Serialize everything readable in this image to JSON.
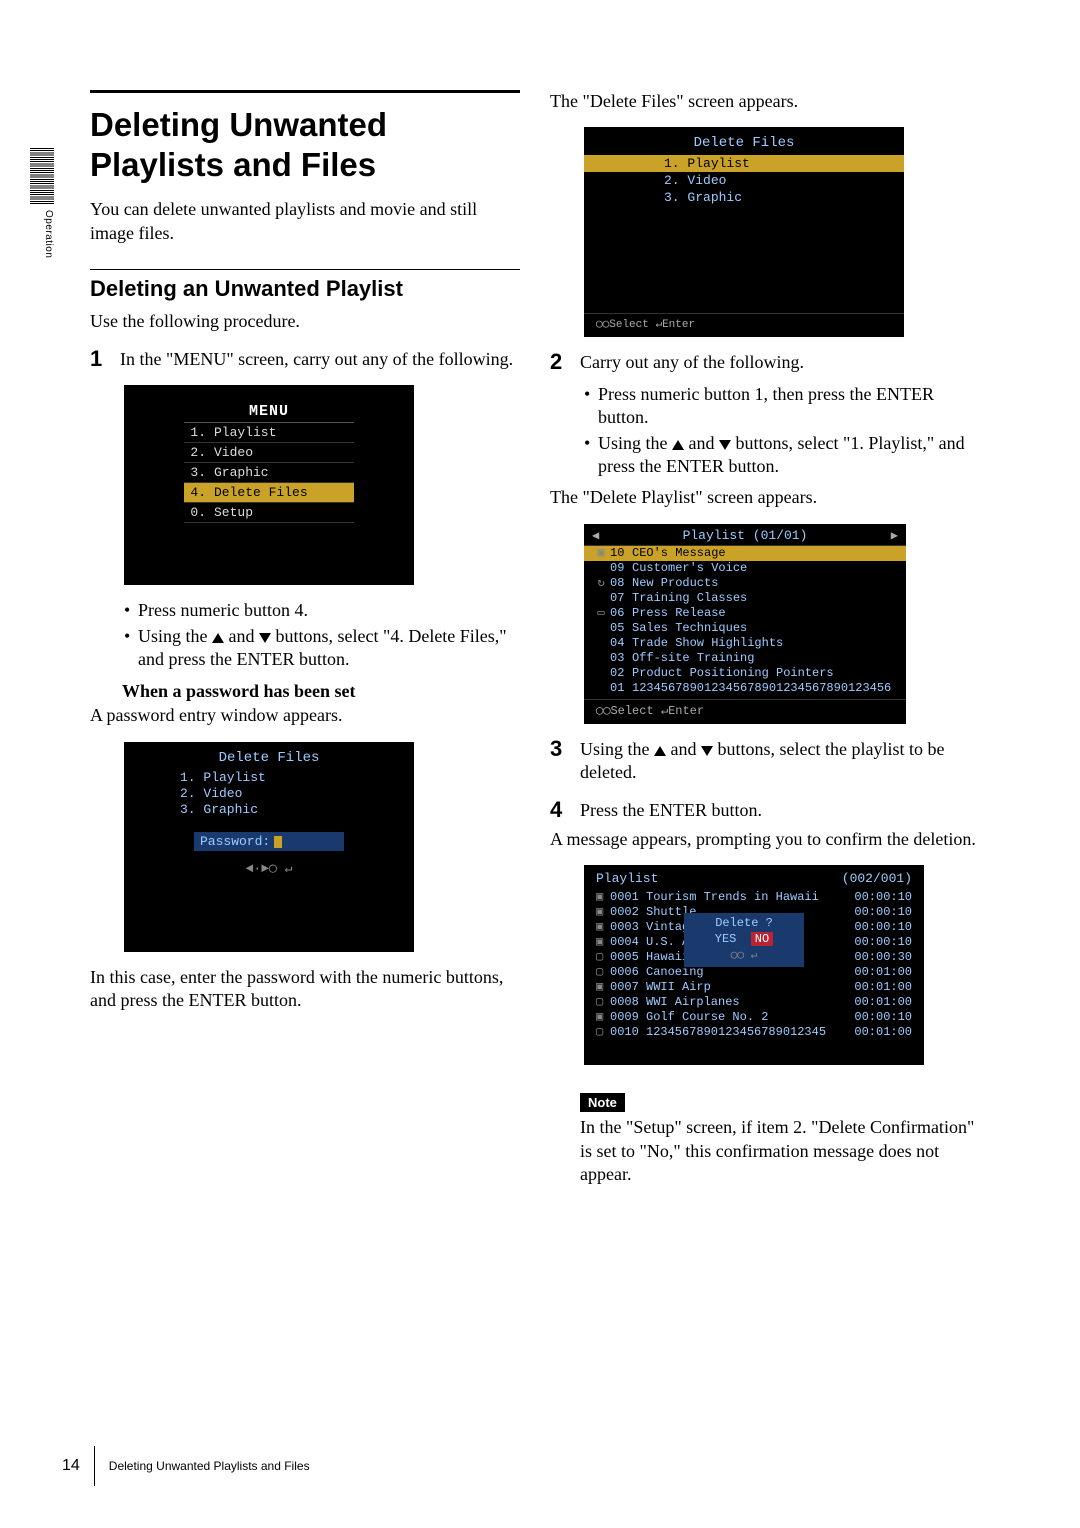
{
  "side_tab": "Operation",
  "heading": "Deleting Unwanted Playlists and Files",
  "intro": "You can delete unwanted playlists and movie and still image files.",
  "subheading": "Deleting an Unwanted Playlist",
  "sub_intro": "Use the following procedure.",
  "step1": {
    "num": "1",
    "text": "In the \"MENU\" screen, carry out any of the following.",
    "menu": {
      "title": "MENU",
      "items": [
        {
          "n": "1.",
          "label": "Playlist"
        },
        {
          "n": "2.",
          "label": "Video"
        },
        {
          "n": "3.",
          "label": "Graphic"
        },
        {
          "n": "4.",
          "label": "Delete Files",
          "selected": true
        },
        {
          "n": "0.",
          "label": "Setup"
        }
      ]
    },
    "bullets": [
      "Press numeric button 4.",
      "Using the ▲ and ▼ buttons, select \"4. Delete Files,\" and press the ENTER button."
    ],
    "pw_head": "When a password has been set",
    "pw_text": "A password entry window appears.",
    "pw_osd": {
      "title": "Delete Files",
      "items": [
        "1. Playlist",
        "2. Video",
        "3. Graphic"
      ],
      "pass_label": "Password:",
      "icons": "◄·►◯   ↵"
    },
    "pw_after": "In this case, enter the password with the numeric buttons, and press the ENTER button."
  },
  "right_intro": "The \"Delete Files\" screen appears.",
  "delsel": {
    "title": "Delete Files",
    "items": [
      {
        "n": "1.",
        "label": "Playlist",
        "selected": true
      },
      {
        "n": "2.",
        "label": "Video"
      },
      {
        "n": "3.",
        "label": "Graphic"
      }
    ],
    "footer": "◯◯Select  ↵Enter"
  },
  "step2": {
    "num": "2",
    "text": "Carry out any of the following.",
    "bullets": [
      "Press numeric button 1, then press the ENTER button.",
      "Using the ▲ and ▼ buttons, select \"1. Playlist,\" and press the ENTER button."
    ],
    "after": "The \"Delete Playlist\" screen appears."
  },
  "dplist": {
    "title": "Playlist (01/01)",
    "rows": [
      {
        "ico": "▣",
        "idx": "10",
        "name": "CEO's Message",
        "selected": true
      },
      {
        "ico": "",
        "idx": "09",
        "name": "Customer's Voice"
      },
      {
        "ico": "↻",
        "idx": "08",
        "name": "New Products"
      },
      {
        "ico": "",
        "idx": "07",
        "name": "Training Classes"
      },
      {
        "ico": "▭",
        "idx": "06",
        "name": "Press Release"
      },
      {
        "ico": "",
        "idx": "05",
        "name": "Sales Techniques"
      },
      {
        "ico": "",
        "idx": "04",
        "name": "Trade Show Highlights"
      },
      {
        "ico": "",
        "idx": "03",
        "name": "Off-site Training"
      },
      {
        "ico": "",
        "idx": "02",
        "name": "Product Positioning Pointers"
      },
      {
        "ico": "",
        "idx": "01",
        "name": "123456789012345678901234567890123456"
      }
    ],
    "footer": "◯◯Select  ↵Enter"
  },
  "step3": {
    "num": "3",
    "text": "Using the ▲ and ▼ buttons, select the playlist to be deleted."
  },
  "step4": {
    "num": "4",
    "text": "Press the ENTER button.",
    "after": "A message appears, prompting you to confirm the deletion."
  },
  "plitems": {
    "title_l": "Playlist",
    "title_r": "(002/001)",
    "rows": [
      {
        "box": "▣",
        "idx": "0001",
        "name": "Tourism Trends in Hawaii",
        "dur": "00:00:10"
      },
      {
        "box": "▣",
        "idx": "0002",
        "name": "Shuttle",
        "dur": "00:00:10"
      },
      {
        "box": "▣",
        "idx": "0003",
        "name": "Vintage Clothing",
        "dur": "00:00:10"
      },
      {
        "box": "▣",
        "idx": "0004",
        "name": "U.S. Astr",
        "dur": "00:00:10"
      },
      {
        "box": "▢",
        "idx": "0005",
        "name": "Hawaii Va",
        "dur": "00:00:30"
      },
      {
        "box": "▢",
        "idx": "0006",
        "name": "Canoeing",
        "dur": "00:01:00"
      },
      {
        "box": "▣",
        "idx": "0007",
        "name": "WWII Airp",
        "dur": "00:01:00"
      },
      {
        "box": "▢",
        "idx": "0008",
        "name": "WWI Airplanes",
        "dur": "00:01:00"
      },
      {
        "box": "▣",
        "idx": "0009",
        "name": "Golf Course No. 2",
        "dur": "00:00:10"
      },
      {
        "box": "▢",
        "idx": "0010",
        "name": "1234567890123456789012345",
        "dur": "00:01:00"
      }
    ],
    "dialog": {
      "q": "Delete ?",
      "yes": "YES",
      "no": "NO",
      "arrows": "◯◯   ↵"
    }
  },
  "note": {
    "label": "Note",
    "text": "In the \"Setup\" screen, if item 2. \"Delete Confirmation\" is set to \"No,\" this confirmation message does not appear."
  },
  "footer": {
    "page": "14",
    "title": "Deleting Unwanted Playlists and Files"
  }
}
